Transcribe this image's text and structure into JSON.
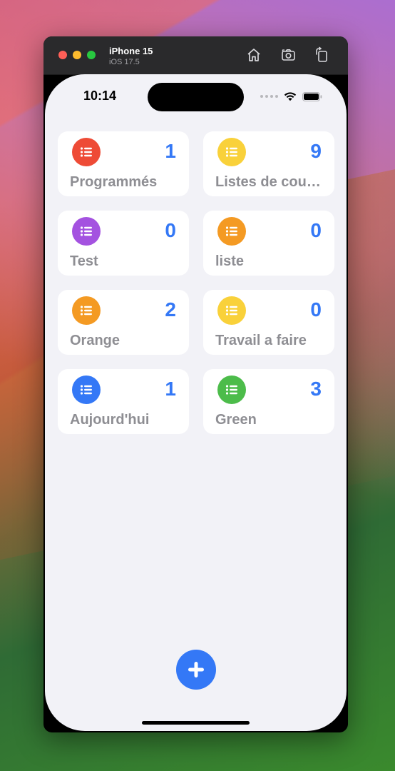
{
  "simulator": {
    "device_name": "iPhone 15",
    "os_version": "iOS 17.5"
  },
  "status_bar": {
    "time": "10:14"
  },
  "lists": [
    {
      "title": "Programmés",
      "count": "1",
      "color": "#ee4b36",
      "icon": "list-bullet-icon"
    },
    {
      "title": "Listes de courses",
      "count": "9",
      "color": "#f9d13a",
      "icon": "list-bullet-icon"
    },
    {
      "title": "Test",
      "count": "0",
      "color": "#a452e0",
      "icon": "list-bullet-icon"
    },
    {
      "title": "liste",
      "count": "0",
      "color": "#f49a23",
      "icon": "list-bullet-icon"
    },
    {
      "title": "Orange",
      "count": "2",
      "color": "#f49a23",
      "icon": "list-bullet-icon"
    },
    {
      "title": "Travail a faire",
      "count": "0",
      "color": "#f9d13a",
      "icon": "list-bullet-icon"
    },
    {
      "title": "Aujourd'hui",
      "count": "1",
      "color": "#3478f6",
      "icon": "list-bullet-icon"
    },
    {
      "title": "Green",
      "count": "3",
      "color": "#4cbc4a",
      "icon": "list-bullet-icon"
    }
  ],
  "add_button": {
    "icon": "plus-icon",
    "color": "#3478f6"
  },
  "colors": {
    "accent": "#3478f6",
    "background": "#f2f2f7",
    "card": "#ffffff",
    "title_text": "#8e8e93"
  }
}
